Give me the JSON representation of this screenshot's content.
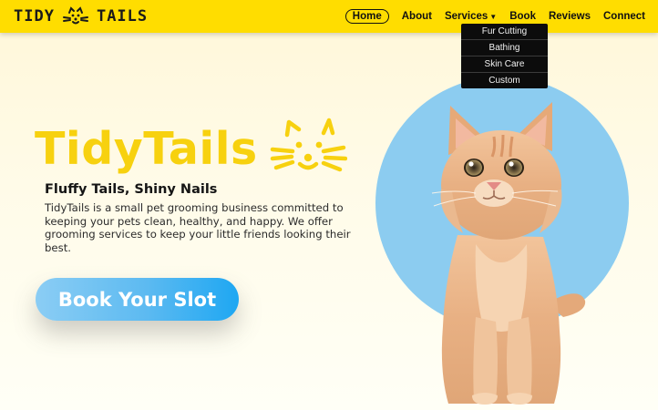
{
  "brand": {
    "left_word": "TIDY",
    "right_word": "TAILS"
  },
  "nav": {
    "items": [
      {
        "label": "Home",
        "active": true
      },
      {
        "label": "About"
      },
      {
        "label": "Services",
        "has_dropdown": true
      },
      {
        "label": "Book"
      },
      {
        "label": "Reviews"
      },
      {
        "label": "Connect"
      }
    ]
  },
  "services_dropdown": {
    "items": [
      "Fur Cutting",
      "Bathing",
      "Skin Care",
      "Custom"
    ]
  },
  "hero": {
    "title": "TidyTails",
    "tagline": "Fluffy Tails, Shiny Nails",
    "description": "TidyTails is a small pet grooming business committed to keeping your pets clean, healthy, and happy. We offer grooming services to keep your little friends looking their best.",
    "cta_label": "Book Your Slot"
  },
  "icons": {
    "brand_logo": "cat-face-icon",
    "hero_logo": "cat-face-icon",
    "dropdown_caret": "caret-down-icon"
  },
  "colors": {
    "nav_background": "#ffdd00",
    "title_yellow": "#f7d10f",
    "circle_blue": "#8cccf0",
    "button_start": "#8bcdf4",
    "button_end": "#1ea7f2",
    "dropdown_background": "#0c0c0c"
  }
}
